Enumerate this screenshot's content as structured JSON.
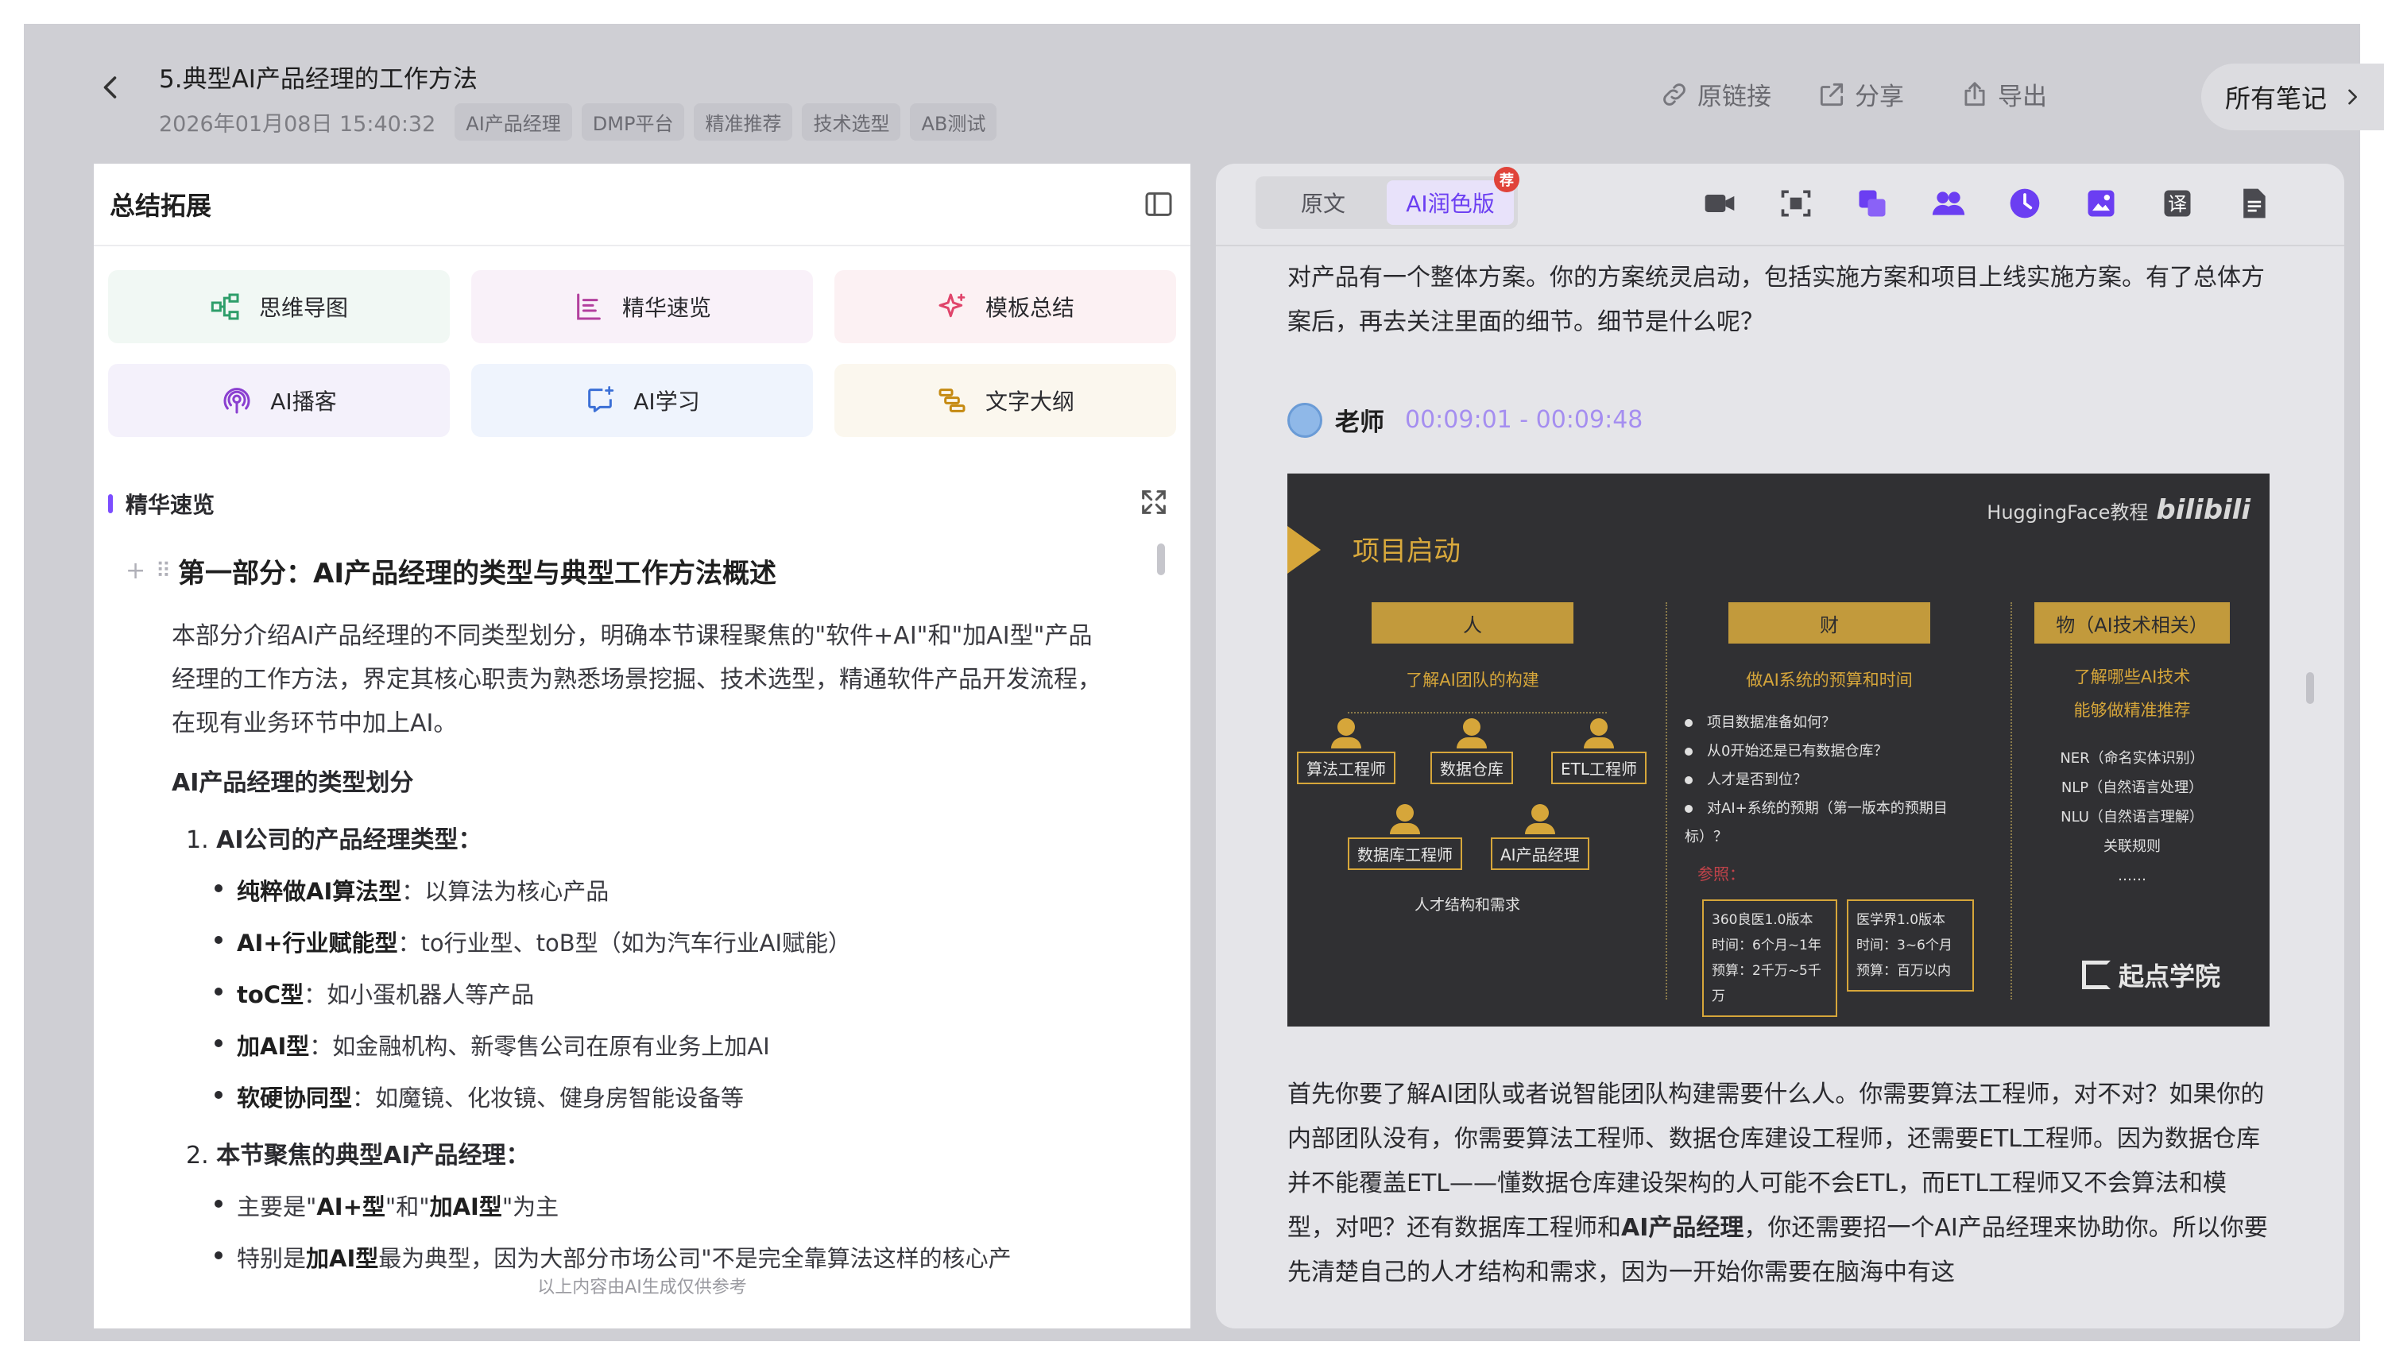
{
  "header": {
    "title": "5.典型AI产品经理的工作方法",
    "date": "2026年01月08日 15:40:32",
    "tags": [
      "AI产品经理",
      "DMP平台",
      "精准推荐",
      "技术选型",
      "AB测试"
    ],
    "actions": {
      "original_link": "原链接",
      "share": "分享",
      "export": "导出"
    },
    "all_notes": "所有笔记"
  },
  "left_panel": {
    "title": "总结拓展",
    "tools": {
      "mindmap": "思维导图",
      "essence": "精华速览",
      "template": "模板总结",
      "podcast": "AI播客",
      "learn": "AI学习",
      "outline": "文字大纲"
    },
    "section_label": "精华速览",
    "heading": "第一部分：AI产品经理的类型与典型工作方法概述",
    "intro": "本部分介绍AI产品经理的不同类型划分，明确本节课程聚焦的\"软件+AI\"和\"加AI型\"产品经理的工作方法，界定其核心职责为熟悉场景挖掘、技术选型，精通软件产品开发流程，在现有业务环节中加上AI。",
    "sub_heading": "AI产品经理的类型划分",
    "ol1": {
      "num": "1.",
      "text": "AI公司的产品经理类型："
    },
    "types": [
      {
        "bold": "纯粹做AI算法型",
        "rest": "：以算法为核心产品"
      },
      {
        "bold": "AI+行业赋能型",
        "rest": "：to行业型、toB型（如为汽车行业AI赋能）"
      },
      {
        "bold": "toC型",
        "rest": "：如小蛋机器人等产品"
      },
      {
        "bold": "加AI型",
        "rest": "：如金融机构、新零售公司在原有业务上加AI"
      },
      {
        "bold": "软硬协同型",
        "rest": "：如魔镜、化妆镜、健身房智能设备等"
      }
    ],
    "ol2": {
      "num": "2.",
      "text": "本节聚焦的典型AI产品经理："
    },
    "focus1": {
      "pre": "主要是\"",
      "b1": "AI+型",
      "mid": "\"和\"",
      "b2": "加AI型",
      "post": "\"为主"
    },
    "focus2": {
      "pre": "特别是",
      "b": "加AI型",
      "post": "最为典型，因为大部分市场公司\"不是完全靠算法这样的核心产"
    },
    "disclaimer": "以上内容由AI生成仅供参考"
  },
  "right_panel": {
    "tabs": {
      "original": "原文",
      "polished": "AI润色版"
    },
    "badge": "荐",
    "toolbar_icons": [
      "video-icon",
      "screenshot-icon",
      "copy-icon",
      "speakers-icon",
      "clock-icon",
      "image-icon",
      "translate-icon",
      "document-icon"
    ],
    "top_text": "对产品有一个整体方案。你的方案统灵启动，包括实施方案和项目上线实施方案。有了总体方案后，再去关注里面的细节。细节是什么呢？",
    "speaker": {
      "name": "老师",
      "time": "00:09:01 - 00:09:48"
    },
    "slide": {
      "title": "项目启动",
      "brand": "HuggingFace教程",
      "brand_logo": "bilibili",
      "col_people": "人",
      "col_money": "财",
      "col_things": "物（AI技术相关）",
      "people_sub": "了解AI团队的构建",
      "money_sub": "做AI系统的预算和时间",
      "things_sub1": "了解哪些AI技术",
      "things_sub2": "能够做精准推荐",
      "roles": [
        "算法工程师",
        "数据仓库",
        "ETL工程师",
        "数据库工程师",
        "AI产品经理"
      ],
      "people_note": "人才结构和需求",
      "money_bullets": [
        "项目数据准备如何？",
        "从0开始还是已有数据仓库？",
        "人才是否到位？",
        "对AI+系统的预期（第一版本的预期目标）？"
      ],
      "ref_label": "参照：",
      "card1": [
        "360良医1.0版本",
        "时间：6个月~1年",
        "预算：2千万~5千万"
      ],
      "card2": [
        "医学界1.0版本",
        "时间：3~6个月",
        "预算：百万以内"
      ],
      "tech": [
        "NER（命名实体识别）",
        "NLP（自然语言处理）",
        "NLU（自然语言理解）",
        "关联规则",
        "……"
      ],
      "logo": "起点学院"
    },
    "bottom_text_pre": "首先你要了解AI团队或者说智能团队构建需要什么人。你需要算法工程师，对不对？如果你的内部团队没有，你需要算法工程师、数据仓库建设工程师，还需要ETL工程师。因为数据仓库并不能覆盖ETL——懂数据仓库建设架构的人可能不会ETL，而ETL工程师又不会算法和模型，对吧？还有数据库工程师和",
    "bottom_text_bold": "AI产品经理",
    "bottom_text_post": "，你还需要招一个AI产品经理来协助你。所以你要先清楚自己的人才结构和需求，因为一开始你需要在脑海中有这"
  }
}
